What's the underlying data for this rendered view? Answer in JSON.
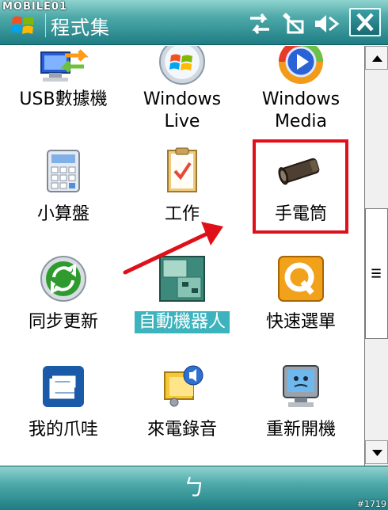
{
  "window": {
    "title": "程式集",
    "watermark_top": "MOBILE01",
    "watermark_bottom": "#1719"
  },
  "status_icons": [
    "connectivity-icon",
    "signal-off-icon",
    "volume-mute-icon"
  ],
  "close_label": "✕",
  "apps": [
    {
      "name": "usb-to-pc",
      "label": "USB數據機",
      "icon": "usb-computer-icon"
    },
    {
      "name": "windows-live",
      "label": "Windows Live",
      "icon": "windows-live-icon"
    },
    {
      "name": "windows-media",
      "label": "Windows Media",
      "icon": "windows-media-icon"
    },
    {
      "name": "calculator",
      "label": "小算盤",
      "icon": "calculator-icon"
    },
    {
      "name": "tasks",
      "label": "工作",
      "icon": "clipboard-icon"
    },
    {
      "name": "flashlight",
      "label": "手電筒",
      "icon": "flashlight-icon"
    },
    {
      "name": "activesync",
      "label": "同步更新",
      "icon": "sync-icon"
    },
    {
      "name": "auto-robot",
      "label": "自動機器人",
      "icon": "robot-icon",
      "selected": true
    },
    {
      "name": "quick-select",
      "label": "快速選單",
      "icon": "q-icon"
    },
    {
      "name": "my-e",
      "label": "我的爪哇",
      "icon": "e-icon"
    },
    {
      "name": "call-recorder",
      "label": "來電錄音",
      "icon": "recorder-icon"
    },
    {
      "name": "restart",
      "label": "重新開機",
      "icon": "restart-icon"
    }
  ],
  "softkey": {
    "label": "ㄅ"
  },
  "colors": {
    "bar_accent": "#1e7d84",
    "selected": "#3cb3bd",
    "annotation": "#e0101a"
  }
}
